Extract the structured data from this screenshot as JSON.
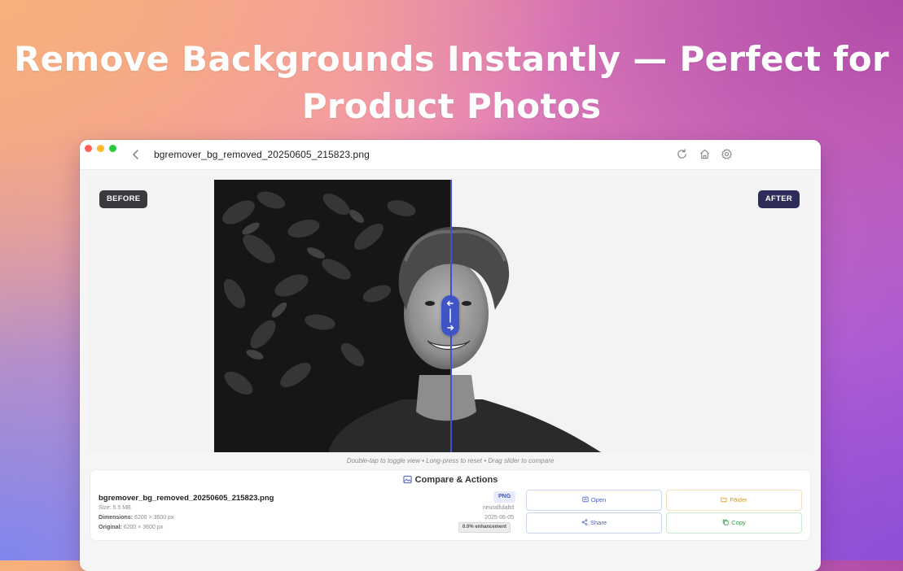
{
  "headline": {
    "line1": "Remove Backgrounds Instantly — Perfect for",
    "line2": "Product Photos"
  },
  "window": {
    "title": "bgremover_bg_removed_20250605_215823.png",
    "icons": [
      "back-chevron-icon",
      "refresh-icon",
      "home-icon",
      "gear-icon"
    ]
  },
  "viewer": {
    "before_label": "BEFORE",
    "after_label": "AFTER",
    "hint": "Double-tap to toggle view • Long-press to reset • Drag slider to compare",
    "slider_position": 0.61
  },
  "panel": {
    "title": "Compare & Actions",
    "file_name": "bgremover_bg_removed_20250605_215823.png",
    "size_label": "Size:",
    "size_value": "5.5 MB",
    "dimensions_label": "Dimensions:",
    "dimensions_value": "6200 × 3600 px",
    "original_label": "Original:",
    "original_value": "6200 × 3600 px",
    "format": "PNG",
    "author": "neuralfulaltd",
    "date": "2025-06-05",
    "enhancement": "0.0% enhancement",
    "actions": {
      "open": "Open",
      "folder": "Folder",
      "share": "Share",
      "copy": "Copy"
    }
  },
  "colors": {
    "accent": "#4a5ec8",
    "folder": "#d69a14",
    "copy": "#2f9a45",
    "slider": "#3e55c8"
  }
}
